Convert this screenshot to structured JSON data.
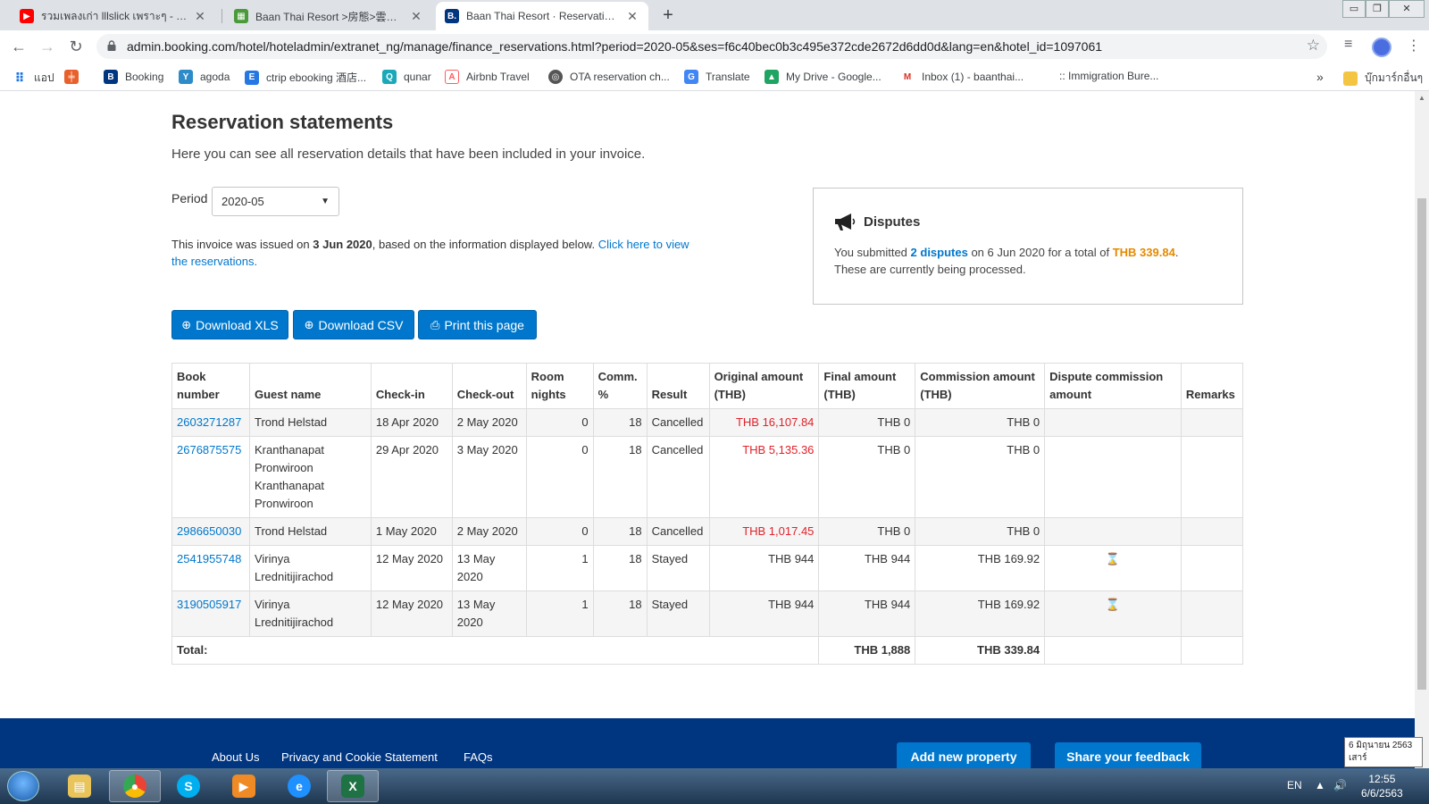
{
  "browser": {
    "tabs": [
      {
        "title": "รวมเพลงเก่า lllslick เพราะๆ - YouTube",
        "close": "✕",
        "icon": "youtube-icon"
      },
      {
        "title": "Baan Thai Resort >房態>雲掌櫃",
        "close": "✕",
        "icon": "hotel-icon"
      },
      {
        "title": "Baan Thai Resort · Reservation statements",
        "close": "✕",
        "icon": "booking-icon"
      }
    ],
    "new_tab": "+",
    "window_controls": {
      "minimize": "▭",
      "restore": "❐",
      "close": "✕"
    },
    "url": "admin.booking.com/hotel/hoteladmin/extranet_ng/manage/finance_reservations.html?period=2020-05&ses=f6c40bec0b3c495e372cde2672d6dd0d&lang=en&hotel_id=1097061",
    "bookmarks": [
      {
        "label": "แอป",
        "color": "#5f6368"
      },
      {
        "label": "",
        "color": "#e8602c"
      },
      {
        "label": "Booking",
        "color": "#003580"
      },
      {
        "label": "agoda",
        "color": "#2e8bc9"
      },
      {
        "label": "ctrip ebooking 酒店...",
        "color": "#2577e3"
      },
      {
        "label": "qunar",
        "color": "#1ba9ba"
      },
      {
        "label": "Airbnb Travel",
        "color": "#ff5a5f"
      },
      {
        "label": "OTA reservation ch...",
        "color": "#555555"
      },
      {
        "label": "Translate",
        "color": "#4285f4"
      },
      {
        "label": "My Drive - Google...",
        "color": "#1fa463"
      },
      {
        "label": "Inbox (1) - baanthai...",
        "color": "#d93025"
      },
      {
        "label": ":: Immigration Bure...",
        "color": "#888888"
      }
    ],
    "bookmarks_more": "»",
    "other_bookmarks": "บุ๊กมาร์กอื่นๆ"
  },
  "page": {
    "title": "Reservation statements",
    "subtitle": "Here you can see all reservation details that have been included in your invoice.",
    "period_label": "Period",
    "period_value": "2020-05",
    "invoice_prefix": "This invoice was issued on ",
    "invoice_date": "3 Jun 2020",
    "invoice_middle": ", based on the information displayed below. ",
    "invoice_link": "Click here to view the reservations."
  },
  "disputes": {
    "title": "Disputes",
    "text_1": "You submitted ",
    "count": "2 disputes",
    "text_2": " on 6 Jun 2020 for a total of ",
    "total": "THB 339.84",
    "text_3": ".",
    "text_4": "These are currently being processed."
  },
  "buttons": {
    "download_xls": "Download XLS",
    "download_csv": "Download CSV",
    "print": "Print this page"
  },
  "table": {
    "headers": {
      "book_number": "Book number",
      "guest_name": "Guest name",
      "check_in": "Check-in",
      "check_out": "Check-out",
      "room_nights": "Room nights",
      "comm": "Comm. %",
      "result": "Result",
      "original": "Original amount (THB)",
      "final": "Final amount (THB)",
      "commission": "Commission amount (THB)",
      "dispute": "Dispute commission amount",
      "remarks": "Remarks"
    },
    "rows": [
      {
        "book": "2603271287",
        "guest": "Trond Helstad",
        "check_in": "18 Apr 2020",
        "check_out": "2 May 2020",
        "nights": "0",
        "comm": "18",
        "result": "Cancelled",
        "original": "THB 16,107.84",
        "final": "THB 0",
        "commission": "THB 0",
        "dispute": "",
        "remarks": ""
      },
      {
        "book": "2676875575",
        "guest": "Kranthanapat Pronwiroon Kranthanapat Pronwiroon",
        "check_in": "29 Apr 2020",
        "check_out": "3 May 2020",
        "nights": "0",
        "comm": "18",
        "result": "Cancelled",
        "original": "THB 5,135.36",
        "final": "THB 0",
        "commission": "THB 0",
        "dispute": "",
        "remarks": ""
      },
      {
        "book": "2986650030",
        "guest": "Trond Helstad",
        "check_in": "1 May 2020",
        "check_out": "2 May 2020",
        "nights": "0",
        "comm": "18",
        "result": "Cancelled",
        "original": "THB 1,017.45",
        "final": "THB 0",
        "commission": "THB 0",
        "dispute": "",
        "remarks": ""
      },
      {
        "book": "2541955748",
        "guest": "Virinya Lrednitijirachod",
        "check_in": "12 May 2020",
        "check_out": "13 May 2020",
        "nights": "1",
        "comm": "18",
        "result": "Stayed",
        "original": "THB 944",
        "final": "THB 944",
        "commission": "THB 169.92",
        "dispute": "⌛",
        "remarks": ""
      },
      {
        "book": "3190505917",
        "guest": "Virinya Lrednitijirachod",
        "check_in": "12 May 2020",
        "check_out": "13 May 2020",
        "nights": "1",
        "comm": "18",
        "result": "Stayed",
        "original": "THB 944",
        "final": "THB 944",
        "commission": "THB 169.92",
        "dispute": "⌛",
        "remarks": ""
      }
    ],
    "total_label": "Total:",
    "total_final": "THB 1,888",
    "total_commission": "THB 339.84"
  },
  "footer": {
    "about": "About Us",
    "privacy": "Privacy and Cookie Statement",
    "faqs": "FAQs",
    "add_property": "Add new property",
    "feedback": "Share your feedback"
  },
  "taskbar": {
    "language": "EN",
    "time": "12:55",
    "date": "6/6/2563",
    "tooltip_line1": "6 มิถุนายน 2563",
    "tooltip_line2": "เสาร์"
  },
  "colors": {
    "brand_blue": "#0077cc",
    "footer_navy": "#003580",
    "amount_red": "#e0222a",
    "dispute_orange": "#e48a00"
  }
}
